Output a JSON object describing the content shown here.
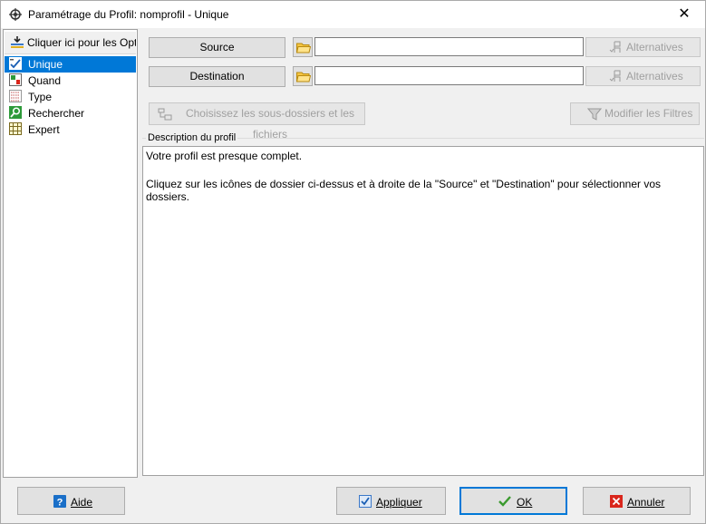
{
  "window": {
    "title": "Paramétrage du Profil: nomprofil - Unique",
    "close_glyph": "✕"
  },
  "sidebar": {
    "options_button": "Cliquer ici pour les Opti",
    "items": [
      {
        "label": "Unique",
        "icon": "unique-icon",
        "selected": true
      },
      {
        "label": "Quand",
        "icon": "quand-icon"
      },
      {
        "label": "Type",
        "icon": "type-icon"
      },
      {
        "label": "Rechercher",
        "icon": "search-icon"
      },
      {
        "label": "Expert",
        "icon": "expert-icon"
      }
    ]
  },
  "main": {
    "source_label": "Source",
    "destination_label": "Destination",
    "source_value": "",
    "destination_value": "",
    "alternatives_label": "Alternatives",
    "subfolders_label": "Choisissez les sous-dossiers et les fichiers",
    "filters_label": "Modifier les Filtres",
    "description_group": "Description du profil",
    "description_line1": "Votre profil est presque complet.",
    "description_line2": "Cliquez sur les icônes de dossier ci-dessus et à droite de la \"Source\" et \"Destination\" pour sélectionner vos dossiers."
  },
  "footer": {
    "help_label": "Aide",
    "apply_label": "Appliquer",
    "ok_label": "OK",
    "cancel_label": "Annuler"
  },
  "colors": {
    "accent": "#0078d7",
    "folder": "#f5c542",
    "cancel_red": "#d9261c",
    "ok_green": "#3a9a2e"
  }
}
